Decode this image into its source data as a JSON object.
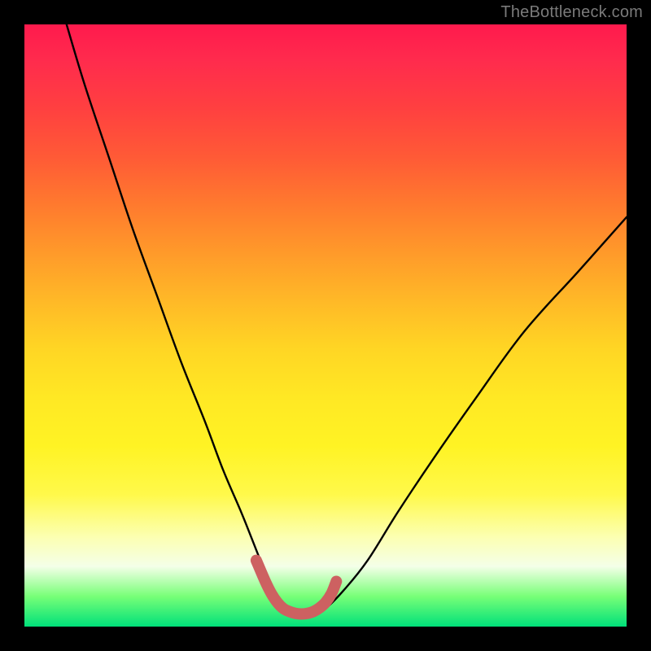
{
  "watermark": "TheBottleneck.com",
  "chart_data": {
    "type": "line",
    "title": "",
    "xlabel": "",
    "ylabel": "",
    "xlim": [
      0,
      100
    ],
    "ylim": [
      0,
      100
    ],
    "series": [
      {
        "name": "bottleneck-curve",
        "x": [
          7,
          10,
          14,
          18,
          22,
          26,
          30,
          33,
          36,
          38,
          40,
          42,
          44,
          46,
          48,
          50,
          53,
          57,
          62,
          68,
          75,
          83,
          92,
          100
        ],
        "values": [
          100,
          90,
          78,
          66,
          55,
          44,
          34,
          26,
          19,
          14,
          9,
          5,
          3,
          2,
          2,
          3,
          6,
          11,
          19,
          28,
          38,
          49,
          59,
          68
        ]
      },
      {
        "name": "highlight-segment",
        "x": [
          38.5,
          40,
          41,
          42,
          43,
          44,
          45,
          46,
          47,
          48,
          49,
          50,
          51,
          51.8
        ],
        "values": [
          11,
          7.5,
          5.5,
          4,
          3,
          2.5,
          2.2,
          2.1,
          2.2,
          2.5,
          3.1,
          4,
          5.5,
          7.5
        ]
      }
    ],
    "highlight_color": "#cd6161",
    "curve_color": "#000000"
  }
}
